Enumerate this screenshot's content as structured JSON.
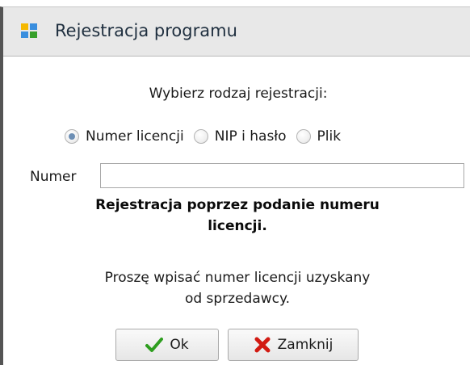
{
  "dialog": {
    "title": "Rejestracja programu",
    "title_icon": "app-blocks-icon"
  },
  "form": {
    "heading": "Wybierz rodzaj rejestracji:",
    "options": [
      {
        "label": "Numer licencji",
        "selected": true
      },
      {
        "label": "NIP i hasło",
        "selected": false
      },
      {
        "label": "Plik",
        "selected": false
      }
    ],
    "field_label": "Numer",
    "field_value": "",
    "bold_info_line1": "Rejestracja poprzez podanie numeru",
    "bold_info_line2": "licencji.",
    "info_line1": "Proszę wpisać numer licencji uzyskany",
    "info_line2": "od sprzedawcy."
  },
  "buttons": {
    "ok_label": "Ok",
    "ok_icon": "checkmark-icon",
    "close_label": "Zamknij",
    "close_icon": "red-x-icon"
  },
  "colors": {
    "radio_selected": "#6d8fb5",
    "check_green": "#2e9e1f",
    "close_red": "#d21a12"
  }
}
